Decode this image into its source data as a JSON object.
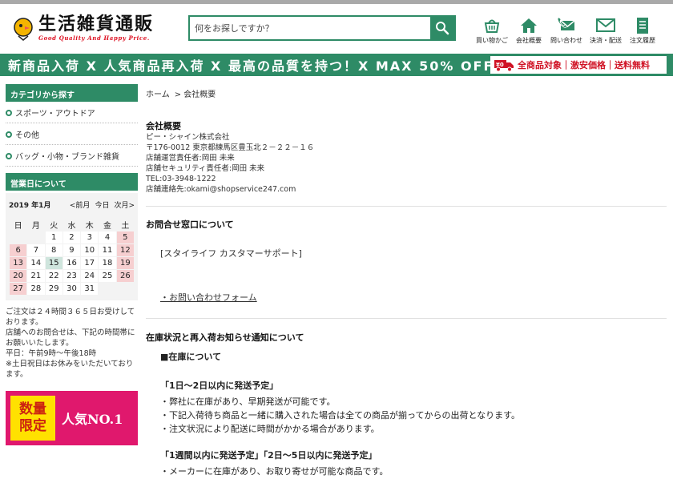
{
  "header": {
    "logo_title": "生活雑貨通販",
    "logo_subtitle": "Good Quality And Happy Price.",
    "search_placeholder": "何をお探しですか？",
    "nav": [
      {
        "label": "買い物かご",
        "icon": "cart-icon"
      },
      {
        "label": "会社概要",
        "icon": "home-icon"
      },
      {
        "label": "問い合わせ",
        "icon": "phone-mail-icon"
      },
      {
        "label": "決済・配送",
        "icon": "mail-icon"
      },
      {
        "label": "注文履歴",
        "icon": "document-icon"
      }
    ]
  },
  "banner": {
    "text": "新商品入荷 X 人気商品再入荷 X 最高の品質を持つ！X MAX 50% OFF",
    "right_badge": "全商品対象｜激安価格｜送料無料",
    "truck_badge": "¥0",
    "colors": {
      "green": "#2e8b66",
      "red": "#d01224"
    }
  },
  "sidebar": {
    "category_head": "カテゴリから探す",
    "categories": [
      "スポーツ・アウトドア",
      "その他",
      "バッグ・小物・ブランド雑貨"
    ],
    "business_head": "営業日について",
    "calendar": {
      "month": "2019 年1月",
      "prev": "<前月",
      "today": "今日",
      "next": "次月>",
      "weekdays": [
        "日",
        "月",
        "火",
        "水",
        "木",
        "金",
        "土"
      ],
      "rows": [
        [
          "",
          "",
          "1",
          "2",
          "3",
          "4",
          "5"
        ],
        [
          "6",
          "7",
          "8",
          "9",
          "10",
          "11",
          "12"
        ],
        [
          "13",
          "14",
          "15",
          "16",
          "17",
          "18",
          "19"
        ],
        [
          "20",
          "21",
          "22",
          "23",
          "24",
          "25",
          "26"
        ],
        [
          "27",
          "28",
          "29",
          "30",
          "31",
          "",
          ""
        ]
      ],
      "holidays": [
        "5",
        "6",
        "12",
        "13",
        "19",
        "20",
        "26",
        "27"
      ],
      "today_day": "15"
    },
    "note": [
      "ご注文は２４時間３６５日お受けしております。",
      "店舗へのお問合せは、下記の時間帯にお願いいたします。",
      "平日：午前9時〜午後18時",
      "※土日祝日はお休みをいただいております。"
    ],
    "promo": {
      "box_top": "数量",
      "box_bottom": "限定",
      "text": "人気NO.1"
    }
  },
  "main": {
    "breadcrumb": [
      "ホーム",
      "> 会社概要"
    ],
    "company": {
      "title": "会社概要",
      "lines": [
        "ピー・シャイン株式会社",
        "〒176-0012 東京都練馬区豊玉北２－２２－１６",
        "店舗運営責任者:岡田 未来",
        "店舗セキュリティ責任者:岡田 未来",
        "TEL:03-3948-1222",
        "店舗連絡先:okami@shopservice247.com"
      ]
    },
    "contact": {
      "title": "お問合せ窓口について",
      "body": "[スタイライフ カスタマーサポート]",
      "link": "・お問い合わせフォーム"
    },
    "stock": {
      "title": "在庫状況と再入荷お知らせ通知について",
      "sub": "■在庫について",
      "label1": "「1日〜2日以内に発送予定」",
      "items1": [
        "・弊社に在庫があり、早期発送が可能です。",
        "・下記入荷待ち商品と一緒に購入された場合は全ての商品が揃ってからの出荷となります。",
        "・注文状況により配送に時間がかかる場合があります。"
      ],
      "label2": "「1週間以内に発送予定」「2日〜5日以内に発送予定」",
      "items2": [
        "・メーカーに在庫があり、お取り寄せが可能な商品です。"
      ]
    }
  }
}
